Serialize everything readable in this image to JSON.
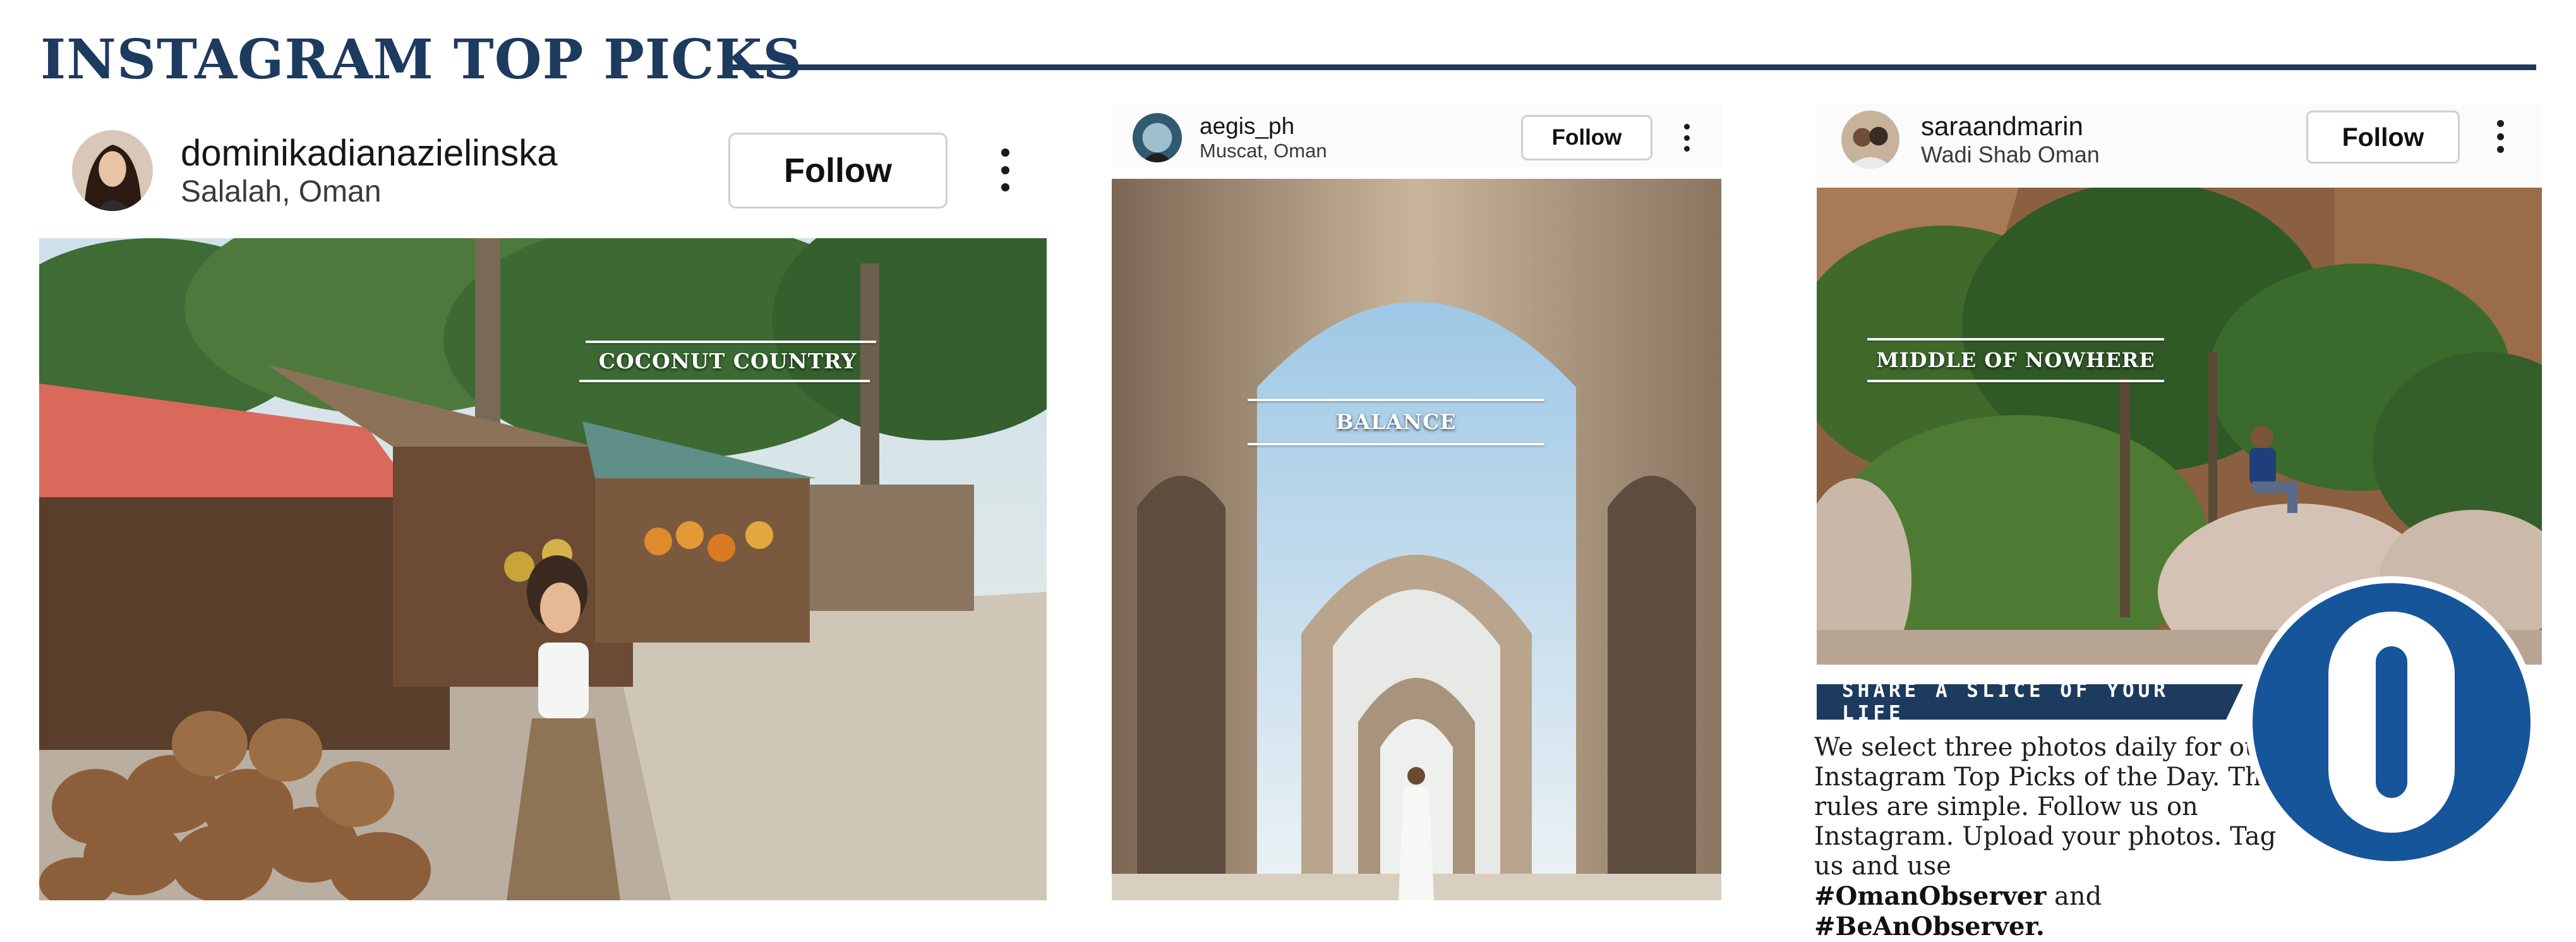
{
  "header": {
    "title": "INSTAGRAM TOP PICKS"
  },
  "posts": [
    {
      "username": "dominikadianazielinska",
      "location": "Salalah, Oman",
      "follow_label": "Follow",
      "caption": "COCONUT COUNTRY",
      "avatar_icon": "profile-photo",
      "more_icon": "more-options-icon"
    },
    {
      "username": "aegis_ph",
      "location": "Muscat, Oman",
      "follow_label": "Follow",
      "caption": "BALANCE",
      "avatar_icon": "profile-photo",
      "more_icon": "more-options-icon"
    },
    {
      "username": "saraandmarin",
      "location": "Wadi Shab Oman",
      "follow_label": "Follow",
      "caption": "MIDDLE OF NOWHERE",
      "avatar_icon": "profile-photo",
      "more_icon": "more-options-icon"
    }
  ],
  "info": {
    "banner": "SHARE A SLICE OF YOUR LIFE",
    "body": "We select three photos daily for our Instagram Top Picks of the Day. The rules are simple. Follow us on Instagram. Upload your photos. Tag us and use",
    "hashtag_1": "#OmanObserver",
    "connector": "and",
    "hashtag_2": "#BeAnObserver."
  },
  "colors": {
    "brand_navy": "#1d3a5f",
    "logo_blue": "#16559a",
    "follow_border": "#cfcfcf"
  }
}
